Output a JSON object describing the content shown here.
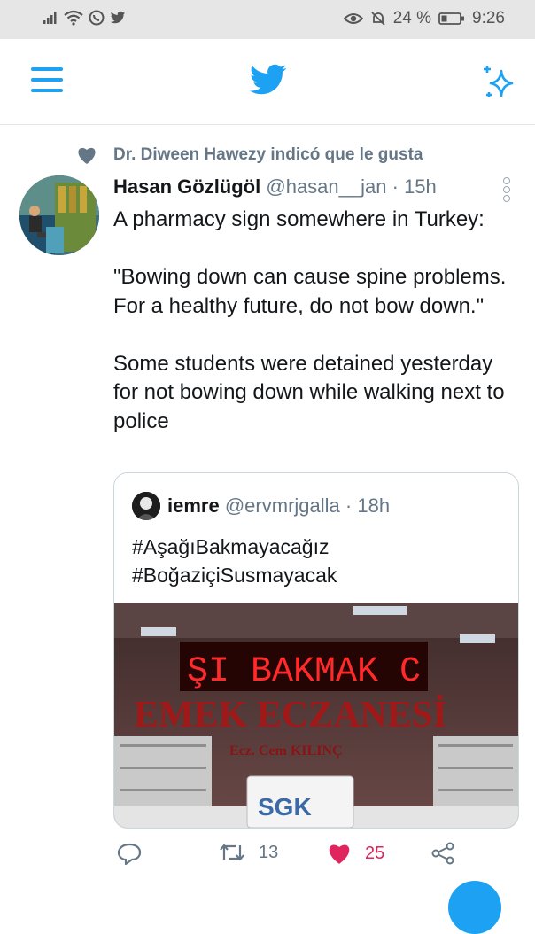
{
  "status_bar": {
    "battery": "24 %",
    "time": "9:26"
  },
  "app_bar": {
    "menu_icon": "hamburger-icon",
    "logo_icon": "twitter-bird-icon",
    "sparkle_icon": "sparkle-icon",
    "accent": "#1da1f2"
  },
  "tweet": {
    "context": "Dr. Diween Hawezy indicó que le gusta",
    "author_name": "Hasan Gözlügöl",
    "author_handle": "@hasan__jan",
    "separator": "·",
    "time": "15h",
    "text_lines": [
      "A pharmacy sign somewhere in Turkey:",
      "\"Bowing down can cause spine problems. For a healthy future, do not bow down.\"",
      "Some students were detained yesterday for not bowing down while walking next to police"
    ],
    "quote": {
      "author_name": "iemre",
      "author_handle": "@ervmrjgalla",
      "separator": "·",
      "time": "18h",
      "hashtags": [
        "#AşağıBakmayacağız",
        "#BoğaziçiSusmayacak"
      ],
      "image": {
        "led_text": "ŞI BAKMAK C",
        "sign_text": "EMEK ECZANESİ",
        "sub_text": "Ecz. Cem KILINÇ",
        "box_text": "SGK"
      }
    },
    "actions": {
      "reply_icon": "reply-icon",
      "retweet_icon": "retweet-icon",
      "retweet_count": "13",
      "like_icon": "heart-icon",
      "like_count": "25",
      "share_icon": "share-icon",
      "like_color": "#e0245e"
    }
  }
}
